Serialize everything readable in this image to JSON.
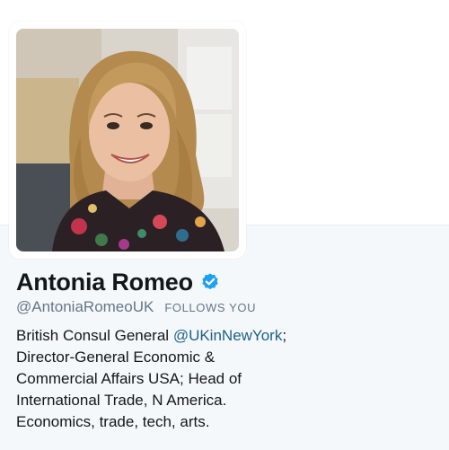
{
  "profile": {
    "name": "Antonia Romeo",
    "handle": "@AntoniaRomeoUK",
    "follows_badge": "FOLLOWS YOU",
    "verified_icon": "verified-badge-icon",
    "accent_color": "#1da1f2",
    "bio": {
      "line1_prefix": "British Consul General ",
      "line1_mention": "@UKinNewYork",
      "line1_suffix": ";",
      "line2": "Director-General Economic &",
      "line3": "Commercial Affairs USA; Head of",
      "line4": "International Trade, N America.",
      "line5": "Economics, trade, tech, arts."
    }
  }
}
